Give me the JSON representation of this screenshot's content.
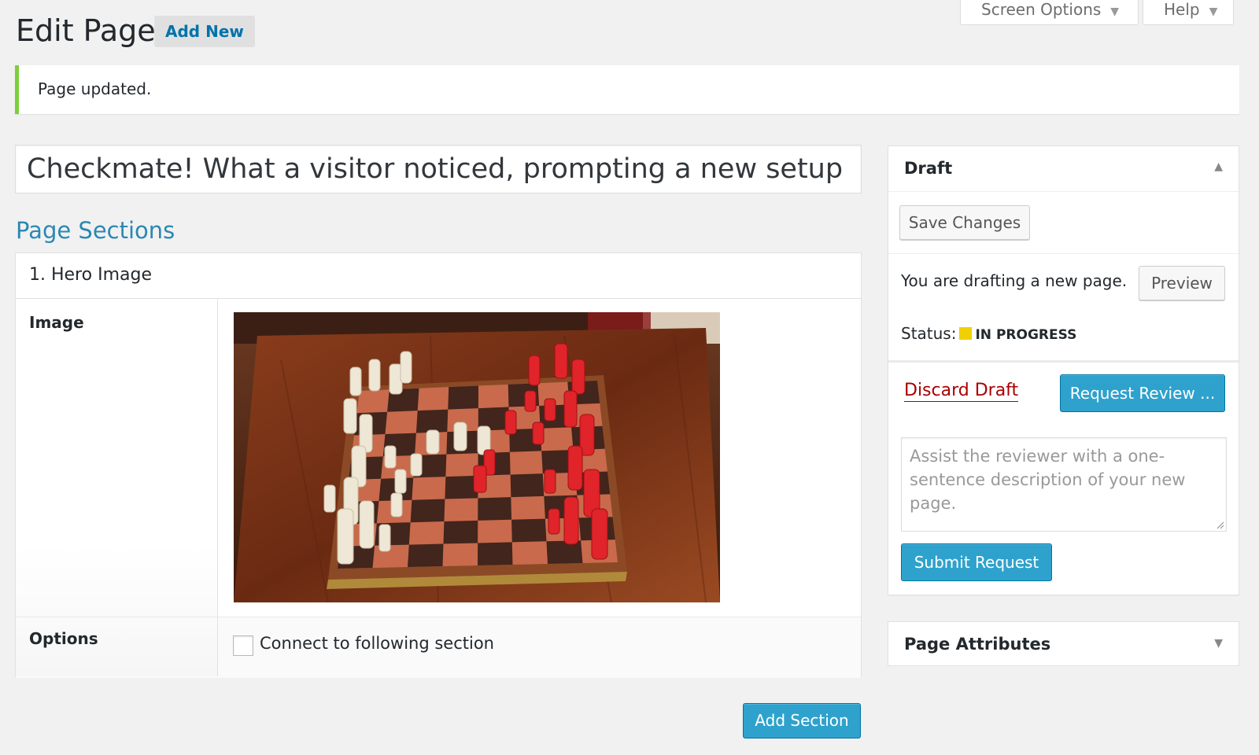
{
  "header": {
    "title": "Edit Page",
    "add_new": "Add New",
    "screen_options": "Screen Options",
    "help": "Help",
    "arrow": "▼"
  },
  "notice": {
    "text": "Page updated."
  },
  "post": {
    "title_value": "Checkmate! What a visitor noticed, prompting a new setup of the chess set"
  },
  "sections": {
    "heading": "Page Sections",
    "items": [
      {
        "title": "1. Hero Image",
        "image_label": "Image",
        "image_icon": "chess-photo",
        "options_label": "Options",
        "connect_label": "Connect to following section",
        "connect_checked": false
      }
    ],
    "add_button": "Add Section"
  },
  "draft_panel": {
    "title": "Draft",
    "caret": "▲",
    "save_changes": "Save Changes",
    "drafting_text": "You are drafting a new page.",
    "preview": "Preview",
    "status_label": "Status:",
    "status_value": "IN PROGRESS",
    "status_color": "#f0d000",
    "discard": "Discard Draft",
    "request_review": "Request Review ...",
    "review_placeholder": "Assist the reviewer with a one-sentence description of your new page.",
    "submit_request": "Submit Request"
  },
  "attributes_panel": {
    "title": "Page Attributes",
    "caret": "▼"
  },
  "colors": {
    "accent": "#2ea2cc",
    "link": "#0073aa",
    "notice_green": "#7ad03a",
    "danger": "#aa0000"
  }
}
